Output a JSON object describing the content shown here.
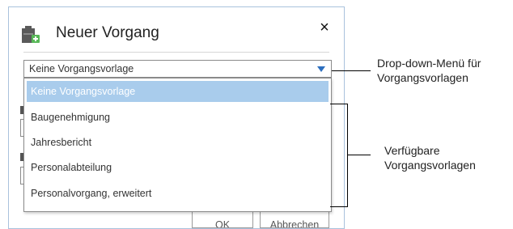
{
  "dialog": {
    "title": "Neuer Vorgang",
    "close_glyph": "×",
    "select_value": "Keine Vorgangsvorlage",
    "dropdown_items": [
      "Keine Vorgangsvorlage",
      "Baugenehmigung",
      "Jahresbericht",
      "Personalabteilung",
      "Personalvorgang, erweitert"
    ],
    "selected_index": 0,
    "ok_label": "OK",
    "cancel_label": "Abbrechen"
  },
  "callouts": {
    "dropdown_line1": "Drop-down-Menü für",
    "dropdown_line2": "Vorgangsvorlagen",
    "available_line1": "Verfügbare",
    "available_line2": "Vorgangsvorlagen"
  },
  "colors": {
    "highlight": "#a9ccec",
    "arrow": "#2d6fbf",
    "dialog_border": "#a9c2dd"
  },
  "icons": {
    "title": "file-cabinet-icon",
    "close": "close-icon",
    "select_arrow": "triangle-down-icon"
  }
}
